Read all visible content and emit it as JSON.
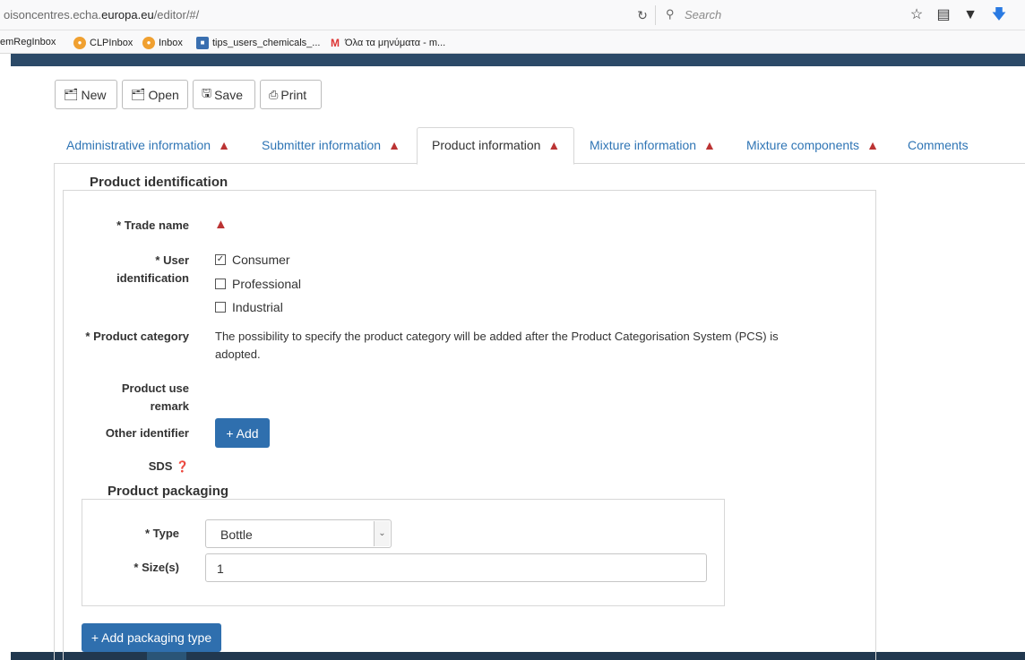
{
  "browser": {
    "url_prefix": "oisoncentres.echa.",
    "url_domain": "europa.eu",
    "url_suffix": "/editor/#/",
    "search_placeholder": "Search"
  },
  "bookmarks": [
    {
      "label": "emRegInbox"
    },
    {
      "label": "CLPInbox"
    },
    {
      "label": "Inbox"
    },
    {
      "label": "tips_users_chemicals_..."
    },
    {
      "label": "Όλα τα μηνύματα - m..."
    }
  ],
  "toolbar": {
    "new_label": "New",
    "open_label": "Open",
    "save_label": "Save",
    "print_label": "Print"
  },
  "tabs": [
    {
      "label": "Administrative information",
      "warning": true
    },
    {
      "label": "Submitter information",
      "warning": true
    },
    {
      "label": "Product information",
      "warning": true,
      "active": true
    },
    {
      "label": "Mixture information",
      "warning": true
    },
    {
      "label": "Mixture components",
      "warning": true
    },
    {
      "label": "Comments",
      "warning": false
    }
  ],
  "product_identification": {
    "legend": "Product identification",
    "trade_name_label": "* Trade name",
    "user_identification_label_1": "* User",
    "user_identification_label_2": "identification",
    "user_options": [
      {
        "label": "Consumer",
        "checked": true
      },
      {
        "label": "Professional",
        "checked": false
      },
      {
        "label": "Industrial",
        "checked": false
      }
    ],
    "product_category_label": "* Product category",
    "product_category_text_1": "The possibility to specify the product category will be added after the Product Categorisation System (PCS) is",
    "product_category_text_2": "adopted.",
    "product_use_remark_label_1": "Product use",
    "product_use_remark_label_2": "remark",
    "other_identifier_label": "Other identifier",
    "add_button": "+ Add",
    "sds_label": "SDS"
  },
  "product_packaging": {
    "legend": "Product packaging",
    "type_label": "* Type",
    "type_value": "Bottle",
    "size_label": "* Size(s)",
    "size_value": "1",
    "add_packaging_button": "+ Add packaging type"
  },
  "colors": {
    "link": "#2f75b5",
    "warning": "#bb3333",
    "primary_button": "#2f6fae",
    "frame": "#2c4a68"
  }
}
